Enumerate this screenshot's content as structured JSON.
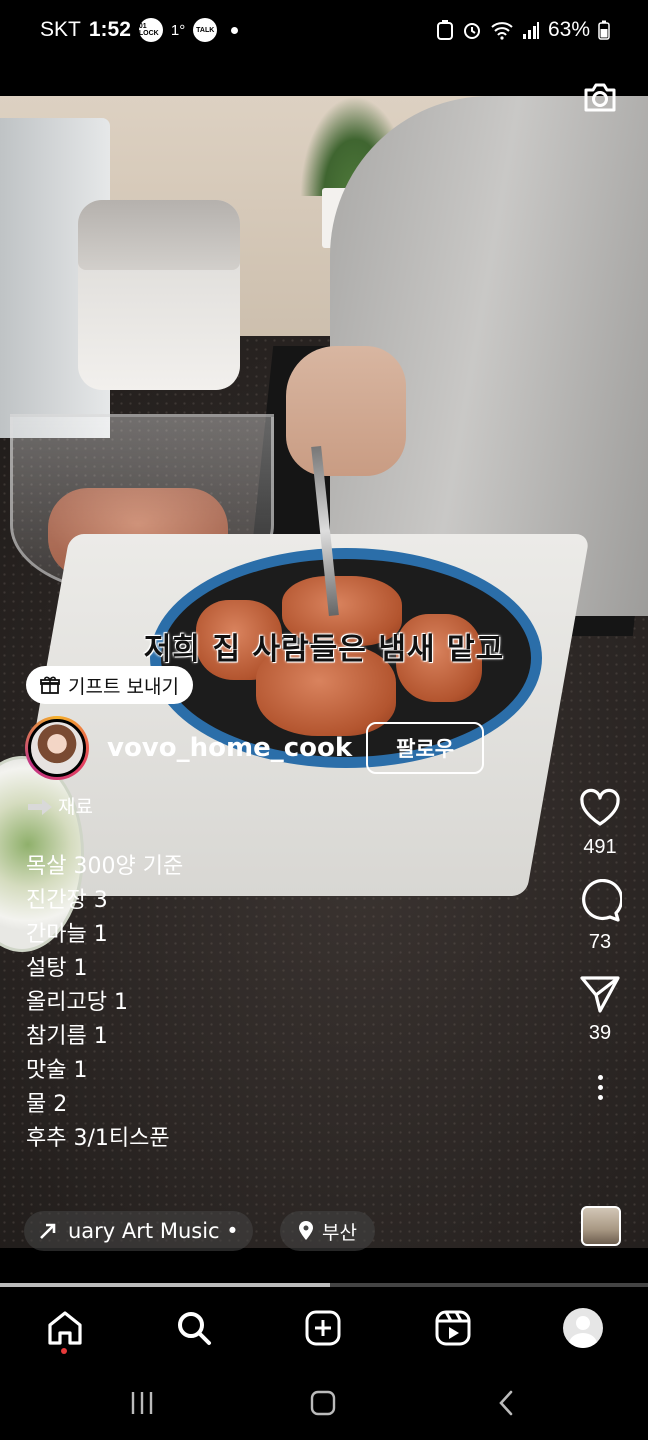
{
  "status_bar": {
    "carrier": "SKT",
    "time": "1:52",
    "lock_badge": "01 LOCK",
    "temperature": "1°",
    "talk_badge": "TALK",
    "battery": "63%"
  },
  "video": {
    "caption": "저희 집 사람들은 냄새 맡고"
  },
  "overlay": {
    "gift_label": "기프트 보내기",
    "username": "vovo_home_cook",
    "follow_label": "팔로우",
    "description_header": "재료",
    "ingredients": [
      "목살 300양 기준",
      "진간장 3",
      "간마늘 1",
      "설탕 1",
      "올리고당 1",
      "참기름 1",
      "맛술 1",
      "물 2",
      "후추 3/1티스푼"
    ],
    "music": "uary  Art Music •",
    "location": "부산"
  },
  "actions": {
    "likes": "491",
    "comments": "73",
    "shares": "39"
  },
  "progress": {
    "fraction": 0.51
  },
  "icons": {
    "camera": "camera-icon",
    "like": "heart-icon",
    "comment": "comment-icon",
    "share": "send-icon",
    "more": "more-icon",
    "home": "home-icon",
    "search": "search-icon",
    "create": "plus-square-icon",
    "reels": "reels-icon",
    "profile": "profile-icon"
  },
  "colors": {
    "background": "#000000",
    "accent_red": "#e83a3a",
    "pan_blue": "#2b6ea9"
  }
}
